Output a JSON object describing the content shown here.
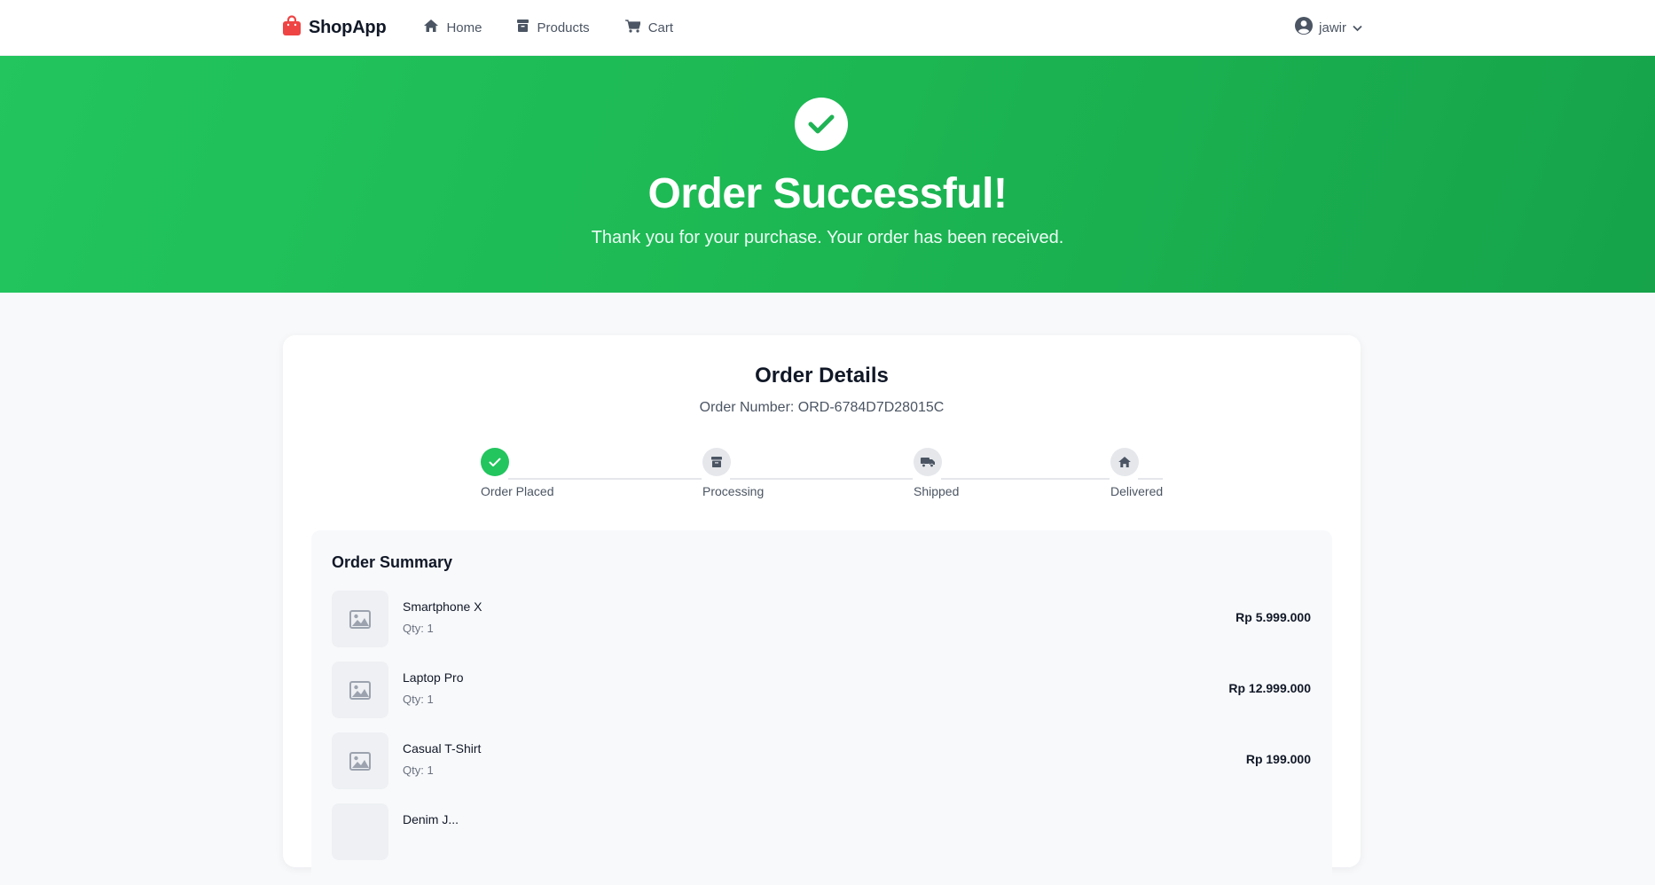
{
  "nav": {
    "brand": "ShopApp",
    "links": [
      {
        "label": "Home",
        "icon": "home-icon"
      },
      {
        "label": "Products",
        "icon": "box-icon"
      },
      {
        "label": "Cart",
        "icon": "cart-icon"
      }
    ],
    "user": "jawir"
  },
  "hero": {
    "title": "Order Successful!",
    "subtitle": "Thank you for your purchase. Your order has been received."
  },
  "order": {
    "title": "Order Details",
    "number": "Order Number: ORD-6784D7D28015C",
    "steps": [
      {
        "label": "Order Placed",
        "icon": "check-icon",
        "done": true
      },
      {
        "label": "Processing",
        "icon": "box-icon",
        "done": false
      },
      {
        "label": "Shipped",
        "icon": "truck-icon",
        "done": false
      },
      {
        "label": "Delivered",
        "icon": "home-icon",
        "done": false
      }
    ]
  },
  "summary": {
    "title": "Order Summary",
    "items": [
      {
        "name": "Smartphone X",
        "qty": "Qty: 1",
        "price": "Rp 5.999.000"
      },
      {
        "name": "Laptop Pro",
        "qty": "Qty: 1",
        "price": "Rp 12.999.000"
      },
      {
        "name": "Casual T-Shirt",
        "qty": "Qty: 1",
        "price": "Rp 199.000"
      },
      {
        "name": "Denim J...",
        "qty": "",
        "price": ""
      }
    ]
  },
  "colors": {
    "accent": "#22c55e",
    "brand_icon": "#ef4444",
    "text_dark": "#111827",
    "text_muted": "#4b5563"
  }
}
